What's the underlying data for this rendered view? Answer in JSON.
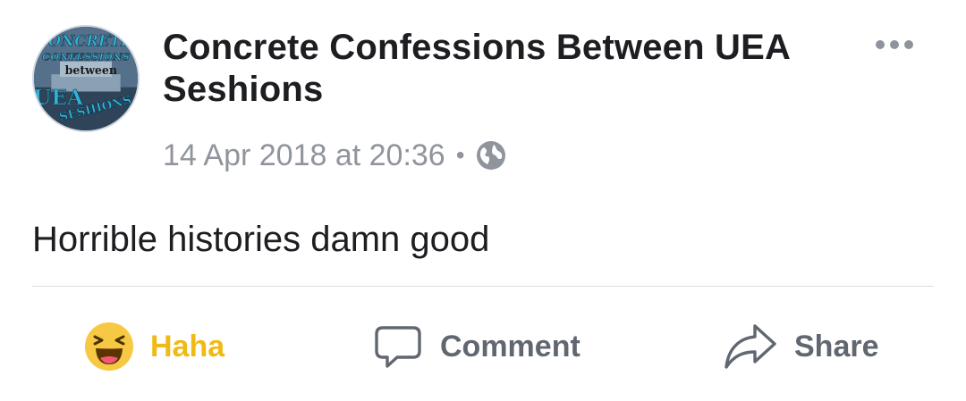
{
  "post": {
    "page_name": "Concrete Confessions Between UEA Seshions",
    "timestamp": "14 Apr 2018 at 20:36",
    "separator": "•",
    "privacy_icon": "globe-icon",
    "text": "Horrible histories damn good",
    "avatar_logo_text": {
      "line1": "CONCRETE",
      "line2": "CONFESSIONS",
      "line3": "between",
      "line4": "UEA",
      "line5": "SESHIONS"
    }
  },
  "actions": {
    "haha": {
      "label": "Haha",
      "icon": "haha-emoji-icon",
      "color": "#f0ba15"
    },
    "comment": {
      "label": "Comment",
      "icon": "comment-bubble-icon"
    },
    "share": {
      "label": "Share",
      "icon": "share-arrow-icon"
    }
  },
  "colors": {
    "title": "#1c1e21",
    "meta": "#90949c",
    "action": "#616770",
    "divider": "#dadde1",
    "haha_face": "#f7c844"
  }
}
